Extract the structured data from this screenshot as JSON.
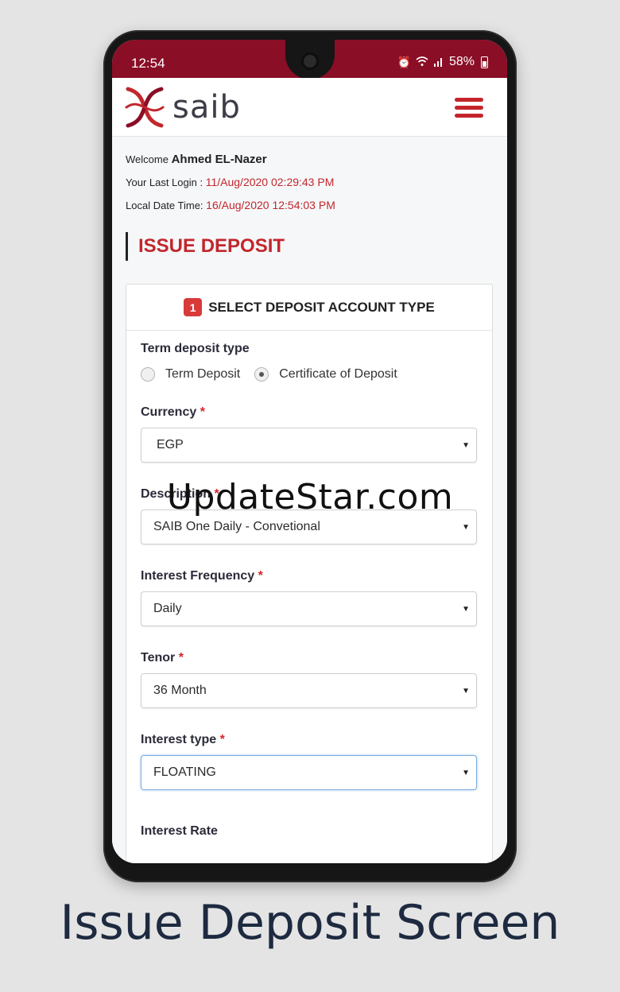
{
  "status_bar": {
    "time": "12:54",
    "battery": "58%",
    "icons": [
      "alarm-icon",
      "wifi-icon",
      "signal-icon",
      "battery-icon"
    ]
  },
  "app": {
    "logo_text": "saib",
    "brand_color": "#8a0e26",
    "accent_red": "#c1272d"
  },
  "user_info": {
    "welcome_prefix": "Welcome",
    "user_name": "Ahmed EL-Nazer",
    "last_login_label": "Your Last Login :",
    "last_login_value": "11/Aug/2020 02:29:43 PM",
    "local_time_label": "Local Date Time:",
    "local_time_value": "16/Aug/2020 12:54:03 PM"
  },
  "page": {
    "title": "ISSUE DEPOSIT"
  },
  "card": {
    "step_number": "1",
    "title": "SELECT DEPOSIT ACCOUNT TYPE",
    "term_deposit_type": {
      "label": "Term deposit type",
      "options": [
        "Term Deposit",
        "Certificate of Deposit"
      ],
      "selected": "Certificate of Deposit"
    },
    "currency": {
      "label": "Currency",
      "required_mark": "*",
      "value": "EGP"
    },
    "description": {
      "label": "Description",
      "required_mark": "*",
      "value": "SAIB One Daily - Convetional"
    },
    "interest_frequency": {
      "label": "Interest Frequency",
      "required_mark": "*",
      "value": "Daily"
    },
    "tenor": {
      "label": "Tenor",
      "required_mark": "*",
      "value": "36 Month"
    },
    "interest_type": {
      "label": "Interest type",
      "required_mark": "*",
      "value": "FLOATING"
    },
    "interest_rate": {
      "label": "Interest Rate"
    }
  },
  "watermark": "UpdateStar.com",
  "caption": "Issue Deposit Screen"
}
